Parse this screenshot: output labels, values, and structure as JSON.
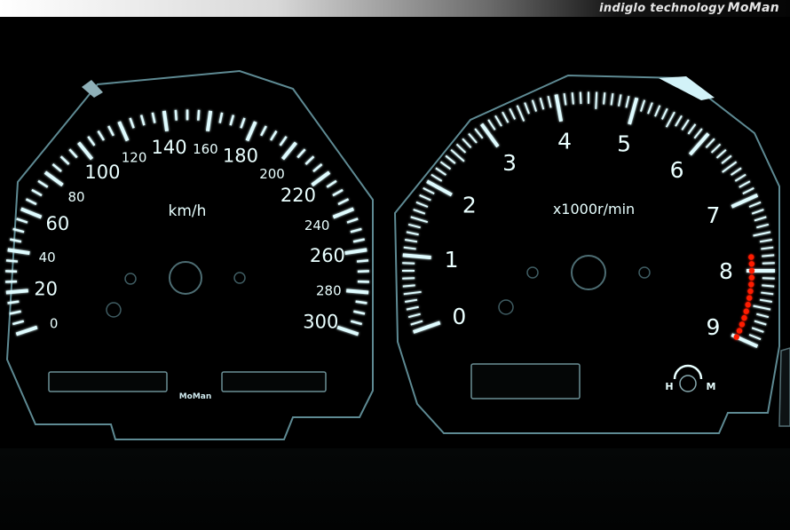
{
  "header": {
    "brand_text": "indiglo technology",
    "brand_mark": "MoMan"
  },
  "speedometer": {
    "unit_label": "km/h",
    "scale_labels": [
      "0",
      "20",
      "40",
      "60",
      "80",
      "100",
      "120",
      "140",
      "160",
      "180",
      "200",
      "220",
      "240",
      "260",
      "280",
      "300"
    ],
    "max_value": 300,
    "logo": "MoMan"
  },
  "tachometer": {
    "unit_label": "x1000r/min",
    "scale_labels": [
      "0",
      "1",
      "2",
      "3",
      "4",
      "5",
      "6",
      "7",
      "8",
      "9"
    ],
    "max_value": 9,
    "redline_start": 7.8,
    "redline_color": "#ff1a00",
    "temp_high_label": "H",
    "temp_low_label": "M"
  },
  "colors": {
    "glow": "#dffcff",
    "background": "#000000",
    "panel_edge": "#7aa9b3"
  }
}
